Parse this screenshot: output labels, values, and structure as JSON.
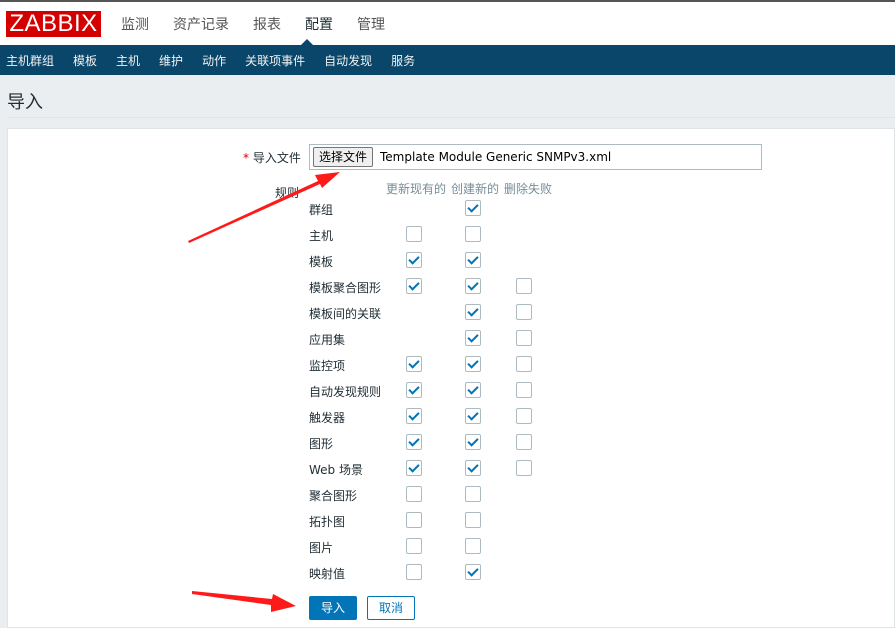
{
  "header": {
    "logo": "ZABBIX",
    "menu": [
      "监测",
      "资产记录",
      "报表",
      "配置",
      "管理"
    ],
    "active": "配置"
  },
  "subnav": [
    "主机群组",
    "模板",
    "主机",
    "维护",
    "动作",
    "关联项事件",
    "自动发现",
    "服务"
  ],
  "page": {
    "title": "导入"
  },
  "form": {
    "file_label": "导入文件",
    "required_mark": "*",
    "file_button": "选择文件",
    "file_name": "Template Module Generic SNMPv3.xml",
    "rules_label": "规则",
    "columns": [
      "更新现有的",
      "创建新的",
      "删除失败"
    ],
    "rules": [
      {
        "name": "群组",
        "update": null,
        "create": true,
        "delete": null
      },
      {
        "name": "主机",
        "update": false,
        "create": false,
        "delete": null
      },
      {
        "name": "模板",
        "update": true,
        "create": true,
        "delete": null
      },
      {
        "name": "模板聚合图形",
        "update": true,
        "create": true,
        "delete": false
      },
      {
        "name": "模板间的关联",
        "update": null,
        "create": true,
        "delete": false
      },
      {
        "name": "应用集",
        "update": null,
        "create": true,
        "delete": false
      },
      {
        "name": "监控项",
        "update": true,
        "create": true,
        "delete": false
      },
      {
        "name": "自动发现规则",
        "update": true,
        "create": true,
        "delete": false
      },
      {
        "name": "触发器",
        "update": true,
        "create": true,
        "delete": false
      },
      {
        "name": "图形",
        "update": true,
        "create": true,
        "delete": false
      },
      {
        "name": "Web 场景",
        "update": true,
        "create": true,
        "delete": false
      },
      {
        "name": "聚合图形",
        "update": false,
        "create": false,
        "delete": null
      },
      {
        "name": "拓扑图",
        "update": false,
        "create": false,
        "delete": null
      },
      {
        "name": "图片",
        "update": false,
        "create": false,
        "delete": null
      },
      {
        "name": "映射值",
        "update": false,
        "create": true,
        "delete": null
      }
    ],
    "import_button": "导入",
    "cancel_button": "取消"
  },
  "colors": {
    "brand": "#d40000",
    "nav": "#0a466a",
    "accent": "#0275b8",
    "annotation_arrow": "#ff1a1a"
  }
}
